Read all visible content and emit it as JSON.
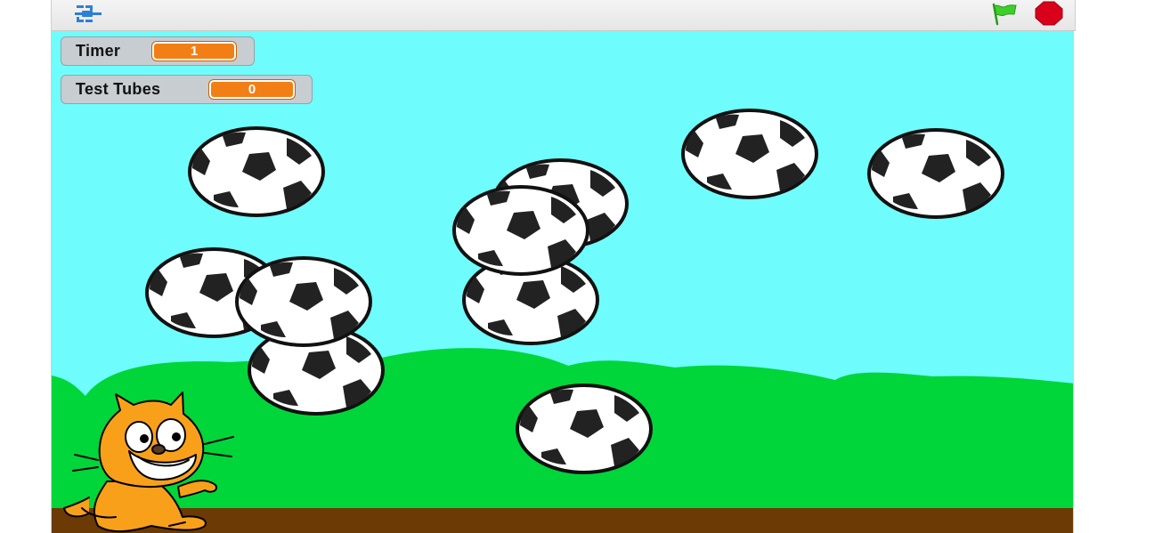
{
  "toolbar": {
    "fullscreen_icon": "fullscreen-toggle-icon",
    "green_flag_icon": "green-flag-icon",
    "stop_icon": "stop-sign-icon"
  },
  "monitors": [
    {
      "label": "Timer",
      "value": "1"
    },
    {
      "label": "Test Tubes",
      "value": "0"
    }
  ],
  "colors": {
    "sky": "#6ffcfc",
    "hills": "#00d639",
    "ground": "#6b3a05",
    "monitor_value": "#f17f16",
    "flag": "#3ecf2a",
    "stop": "#d9001b"
  },
  "sprites": {
    "ball_count": 11,
    "cat": "scratch-cat"
  }
}
